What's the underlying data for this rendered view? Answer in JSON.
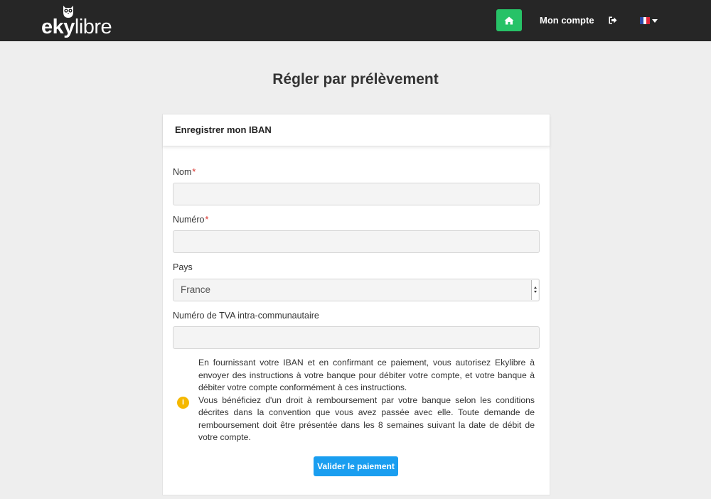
{
  "brand": {
    "name_bold": "eky",
    "name_light": "libre"
  },
  "nav": {
    "account_label": "Mon compte",
    "icons": {
      "home": "home-icon",
      "logout": "sign-out-icon",
      "language": "french-flag-icon"
    }
  },
  "page": {
    "title": "Régler par prélèvement"
  },
  "card": {
    "header": "Enregistrer mon IBAN",
    "fields": {
      "nom": {
        "label": "Nom",
        "required_mark": "*",
        "value": ""
      },
      "numero": {
        "label": "Numéro",
        "required_mark": "*",
        "value": ""
      },
      "pays": {
        "label": "Pays",
        "value": "France"
      },
      "tva": {
        "label": "Numéro de TVA intra-communautaire",
        "value": ""
      }
    },
    "mandate": {
      "paragraph1": "En fournissant votre IBAN et en confirmant ce paiement, vous autorisez Ekylibre à envoyer des instructions à votre banque pour débiter votre compte, et votre banque à débiter votre compte conformément à ces instructions.",
      "paragraph2": "Vous bénéficiez d'un droit à remboursement par votre banque selon les conditions décrites dans la convention que vous avez passée avec elle. Toute demande de remboursement doit être présentée dans les 8 semaines suivant la date de débit de votre compte."
    },
    "submit_label": "Valider le paiement"
  },
  "colors": {
    "navbar": "#262626",
    "home_button": "#27c267",
    "submit_button": "#1a9ef0",
    "required": "#d9302a",
    "info_icon": "#f5b800",
    "background": "#eeeeee"
  }
}
